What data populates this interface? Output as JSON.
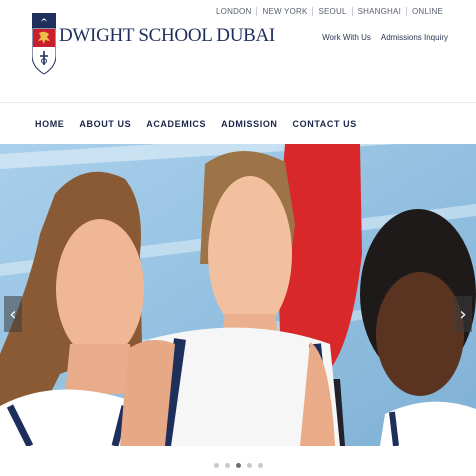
{
  "brand": {
    "name": "DWIGHT SCHOOL DUBAI"
  },
  "cities": [
    "LONDON",
    "NEW YORK",
    "SEOUL",
    "SHANGHAI",
    "ONLINE"
  ],
  "utility_links": [
    "Work With Us",
    "Admissions Inquiry"
  ],
  "nav": [
    "HOME",
    "ABOUT US",
    "ACADEMICS",
    "ADMISSION",
    "CONTACT US"
  ],
  "carousel": {
    "prev_icon": "‹",
    "next_icon": "›",
    "slide_count": 5,
    "active_index": 2
  },
  "colors": {
    "brand_navy": "#1f2f5c",
    "crest_red": "#c8202e",
    "hero_sky": "#9ec7e6"
  }
}
